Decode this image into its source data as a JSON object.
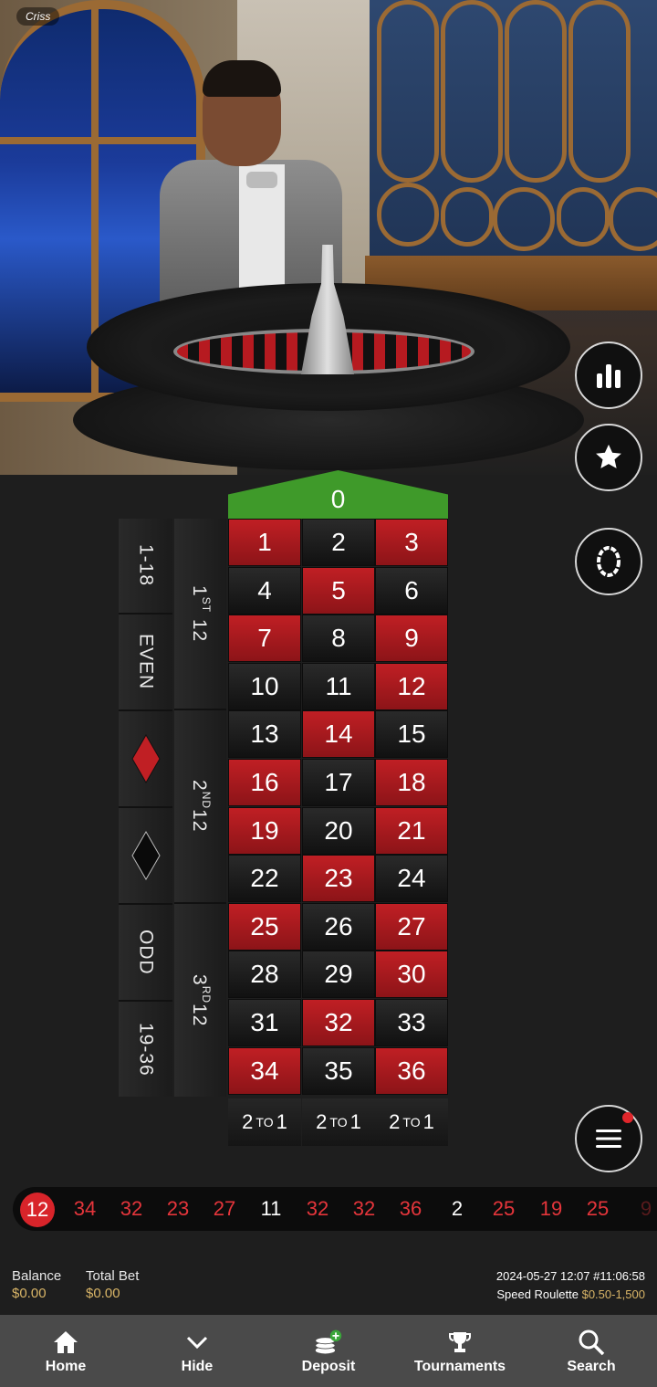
{
  "dealer": {
    "name": "Criss"
  },
  "board": {
    "zero": "0",
    "rows": [
      [
        [
          "1",
          "red"
        ],
        [
          "2",
          "black"
        ],
        [
          "3",
          "red"
        ]
      ],
      [
        [
          "4",
          "black"
        ],
        [
          "5",
          "red"
        ],
        [
          "6",
          "black"
        ]
      ],
      [
        [
          "7",
          "red"
        ],
        [
          "8",
          "black"
        ],
        [
          "9",
          "red"
        ]
      ],
      [
        [
          "10",
          "black"
        ],
        [
          "11",
          "black"
        ],
        [
          "12",
          "red"
        ]
      ],
      [
        [
          "13",
          "black"
        ],
        [
          "14",
          "red"
        ],
        [
          "15",
          "black"
        ]
      ],
      [
        [
          "16",
          "red"
        ],
        [
          "17",
          "black"
        ],
        [
          "18",
          "red"
        ]
      ],
      [
        [
          "19",
          "red"
        ],
        [
          "20",
          "black"
        ],
        [
          "21",
          "red"
        ]
      ],
      [
        [
          "22",
          "black"
        ],
        [
          "23",
          "red"
        ],
        [
          "24",
          "black"
        ]
      ],
      [
        [
          "25",
          "red"
        ],
        [
          "26",
          "black"
        ],
        [
          "27",
          "red"
        ]
      ],
      [
        [
          "28",
          "black"
        ],
        [
          "29",
          "black"
        ],
        [
          "30",
          "red"
        ]
      ],
      [
        [
          "31",
          "black"
        ],
        [
          "32",
          "red"
        ],
        [
          "33",
          "black"
        ]
      ],
      [
        [
          "34",
          "red"
        ],
        [
          "35",
          "black"
        ],
        [
          "36",
          "red"
        ]
      ]
    ],
    "outside_left": [
      "1-18",
      "EVEN",
      "ODD",
      "19-36"
    ],
    "dozens": [
      {
        "num": "1",
        "sup": "ST",
        "rest": "12"
      },
      {
        "num": "2",
        "sup": "ND",
        "rest": "12"
      },
      {
        "num": "3",
        "sup": "RD",
        "rest": "12"
      }
    ],
    "column_bet": {
      "left": "2",
      "mid": "TO",
      "right": "1"
    }
  },
  "history": [
    {
      "n": "12",
      "c": "r",
      "current": true
    },
    {
      "n": "34",
      "c": "r"
    },
    {
      "n": "32",
      "c": "r"
    },
    {
      "n": "23",
      "c": "r"
    },
    {
      "n": "27",
      "c": "r"
    },
    {
      "n": "11",
      "c": "b"
    },
    {
      "n": "32",
      "c": "r"
    },
    {
      "n": "32",
      "c": "r"
    },
    {
      "n": "36",
      "c": "r"
    },
    {
      "n": "2",
      "c": "b"
    },
    {
      "n": "25",
      "c": "r"
    },
    {
      "n": "19",
      "c": "r"
    },
    {
      "n": "25",
      "c": "r"
    },
    {
      "n": "9",
      "c": "r"
    }
  ],
  "info": {
    "balance_label": "Balance",
    "balance_value": "$0.00",
    "total_bet_label": "Total Bet",
    "total_bet_value": "$0.00",
    "timestamp": "2024-05-27 12:07 #11:06:58",
    "game_name": "Speed Roulette",
    "limits": "$0.50-1,500"
  },
  "nav": {
    "home": "Home",
    "hide": "Hide",
    "deposit": "Deposit",
    "tournaments": "Tournaments",
    "search": "Search"
  },
  "colors": {
    "red": "#c01f24",
    "green": "#3f9a2a",
    "gold": "#d9b567",
    "nav_bg": "#4a4a4a"
  }
}
